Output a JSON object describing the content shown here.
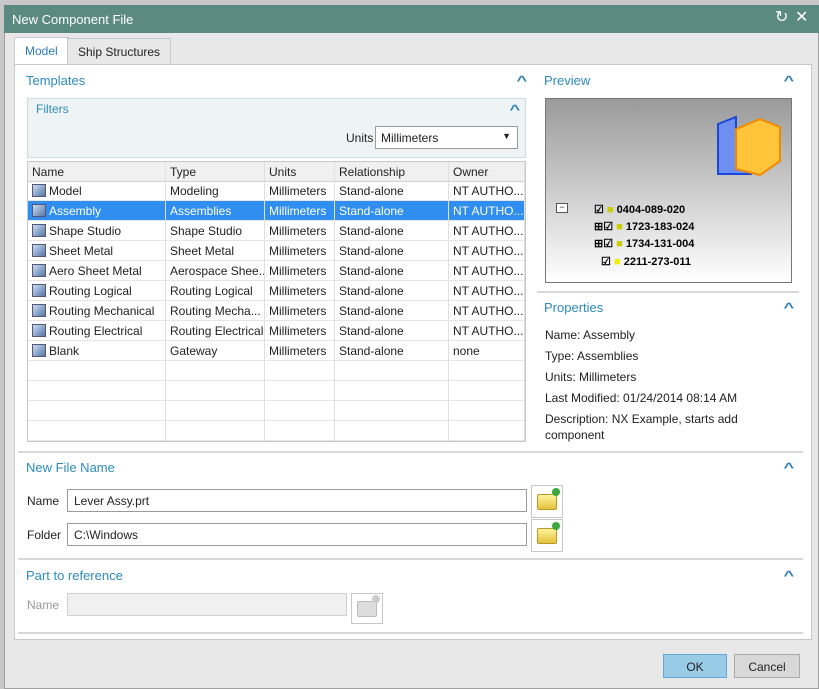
{
  "window": {
    "title": "New Component File",
    "reset_icon": "reset-icon",
    "close_icon": "close-icon"
  },
  "tabs": [
    {
      "label": "Model",
      "active": true
    },
    {
      "label": "Ship Structures",
      "active": false
    }
  ],
  "templates": {
    "title": "Templates",
    "filters": {
      "title": "Filters",
      "units_label": "Units",
      "units_value": "Millimeters"
    },
    "columns": [
      "Name",
      "Type",
      "Units",
      "Relationship",
      "Owner"
    ],
    "rows": [
      {
        "name": "Model",
        "type": "Modeling",
        "units": "Millimeters",
        "relationship": "Stand-alone",
        "owner": "NT AUTHO..."
      },
      {
        "name": "Assembly",
        "type": "Assemblies",
        "units": "Millimeters",
        "relationship": "Stand-alone",
        "owner": "NT AUTHO...",
        "selected": true
      },
      {
        "name": "Shape Studio",
        "type": "Shape Studio",
        "units": "Millimeters",
        "relationship": "Stand-alone",
        "owner": "NT AUTHO..."
      },
      {
        "name": "Sheet Metal",
        "type": "Sheet Metal",
        "units": "Millimeters",
        "relationship": "Stand-alone",
        "owner": "NT AUTHO..."
      },
      {
        "name": "Aero Sheet Metal",
        "type": "Aerospace Shee...",
        "units": "Millimeters",
        "relationship": "Stand-alone",
        "owner": "NT AUTHO..."
      },
      {
        "name": "Routing Logical",
        "type": "Routing Logical",
        "units": "Millimeters",
        "relationship": "Stand-alone",
        "owner": "NT AUTHO..."
      },
      {
        "name": "Routing Mechanical",
        "type": "Routing Mecha...",
        "units": "Millimeters",
        "relationship": "Stand-alone",
        "owner": "NT AUTHO..."
      },
      {
        "name": "Routing Electrical",
        "type": "Routing Electrical",
        "units": "Millimeters",
        "relationship": "Stand-alone",
        "owner": "NT AUTHO..."
      },
      {
        "name": "Blank",
        "type": "Gateway",
        "units": "Millimeters",
        "relationship": "Stand-alone",
        "owner": "none"
      }
    ]
  },
  "preview": {
    "title": "Preview",
    "tree": [
      "0404-089-020",
      "1723-183-024",
      "1734-131-004",
      "2211-273-011"
    ]
  },
  "properties": {
    "title": "Properties",
    "lines": [
      "Name: Assembly",
      "Type: Assemblies",
      "Units: Millimeters",
      "Last Modified: 01/24/2014 08:14 AM",
      "Description: NX Example, starts add",
      "component"
    ]
  },
  "new_file": {
    "title": "New File Name",
    "name_label": "Name",
    "name_value": "Lever Assy.prt",
    "folder_label": "Folder",
    "folder_value": "C:\\Windows"
  },
  "part_ref": {
    "title": "Part to reference",
    "name_label": "Name",
    "name_value": ""
  },
  "buttons": {
    "ok": "OK",
    "cancel": "Cancel"
  }
}
